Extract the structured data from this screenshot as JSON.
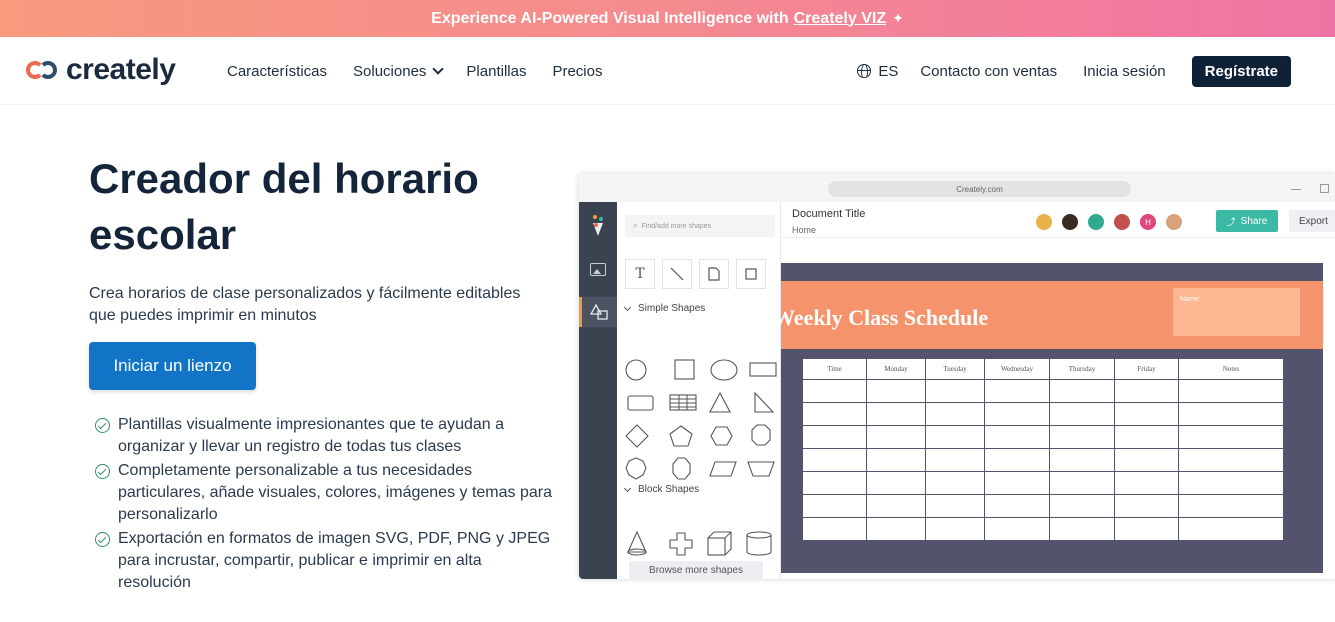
{
  "promo": {
    "text": "Experience AI-Powered Visual Intelligence with",
    "link": "Creately VIZ"
  },
  "nav": {
    "logo": "creately",
    "links": [
      "Características",
      "Soluciones",
      "Plantillas",
      "Precios"
    ],
    "lang": "ES",
    "contact": "Contacto con ventas",
    "login": "Inicia sesión",
    "register": "Regístrate"
  },
  "hero": {
    "title": "Creador del horario escolar",
    "subtitle": "Crea horarios de clase personalizados y fácilmente editables que puedes imprimir en minutos",
    "cta": "Iniciar un lienzo",
    "features": [
      "Plantillas visualmente impresionantes que te ayudan a organizar y llevar un registro de todas tus clases",
      "Completamente personalizable a tus necesidades particulares, añade visuales, colores, imágenes y temas para personalizarlo",
      "Exportación en formatos de imagen SVG, PDF, PNG y JPEG para incrustar, compartir, publicar e imprimir en alta resolución"
    ]
  },
  "app": {
    "url": "Creately.com",
    "search_placeholder": "Find/add more shapes",
    "simple_shapes": "Simple Shapes",
    "block_shapes": "Block Shapes",
    "browse": "Browse more shapes",
    "doc_title": "Document Title",
    "doc_crumb": "Home",
    "avatar_initial": "H",
    "share": "Share",
    "export": "Export",
    "schedule_title": "Weekly  Class Schedule",
    "name_label": "Name:",
    "columns": [
      "Time",
      "Monday",
      "Tuesday",
      "Wednesday",
      "Thursday",
      "Friday",
      "Notes"
    ]
  },
  "colors": {
    "accent": "#1274c7",
    "register_bg": "#0f2137",
    "share": "#3cb9a4",
    "schedule_bg": "#54536e",
    "schedule_header": "#f5936c"
  }
}
